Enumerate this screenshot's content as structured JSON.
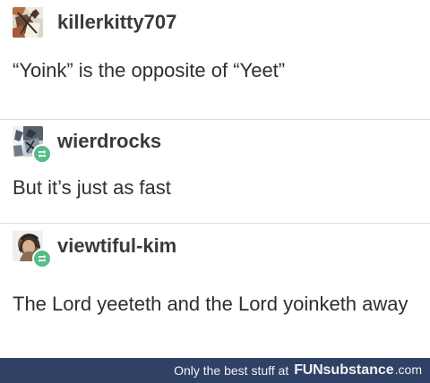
{
  "posts": [
    {
      "username": "killerkitty707",
      "text": "“Yoink” is the opposite of “Yeet”",
      "has_reblog_icon": false,
      "avatar_icon": "comic-avatar-icon"
    },
    {
      "username": "wierdrocks",
      "text": "But it’s just as fast",
      "has_reblog_icon": true,
      "avatar_icon": "comic-avatar-icon"
    },
    {
      "username": "viewtiful-kim",
      "text": "The Lord yeeteth and the Lord yoinketh away",
      "has_reblog_icon": true,
      "avatar_icon": "profile-avatar-icon"
    }
  ],
  "footer": {
    "tagline": "Only the best stuff at",
    "brand_fun": "FUN",
    "brand_substance": "substance",
    "brand_tld": ".com"
  },
  "colors": {
    "footer_background": "#2f4266",
    "reblog_green": "#56bc8a",
    "text": "#2f2f2f"
  }
}
